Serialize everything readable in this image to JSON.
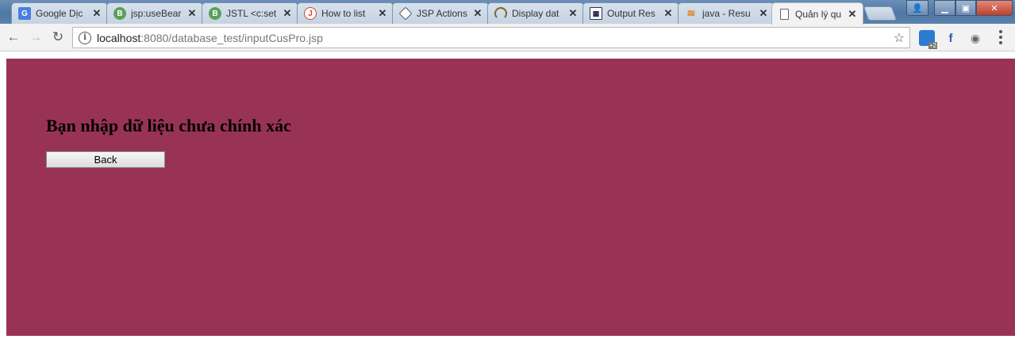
{
  "tabs": [
    {
      "title": "Google Dịc",
      "icon": "google-translate-icon"
    },
    {
      "title": "jsp:useBear",
      "icon": "bootstrap-b-icon"
    },
    {
      "title": "JSTL <c:set",
      "icon": "bootstrap-b-icon"
    },
    {
      "title": "How to list",
      "icon": "j-circle-icon"
    },
    {
      "title": "JSP Actions",
      "icon": "diamond-icon"
    },
    {
      "title": "Display dat",
      "icon": "horseshoe-icon"
    },
    {
      "title": "Output Res",
      "icon": "document-table-icon"
    },
    {
      "title": "java - Resu",
      "icon": "stackoverflow-icon"
    },
    {
      "title": "Quản lý qu",
      "icon": "blank-page-icon"
    }
  ],
  "omnibox": {
    "host": "localhost",
    "path": ":8080/database_test/inputCusPro.jsp"
  },
  "extensions": {
    "badge": "+2"
  },
  "page": {
    "message": "Bạn nhập dữ liệu chưa chính xác",
    "back_label": "Back",
    "background": "#993355"
  }
}
